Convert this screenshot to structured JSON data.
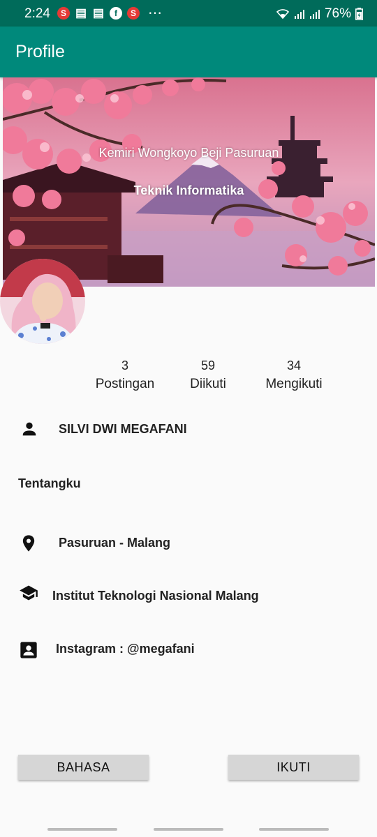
{
  "status_bar": {
    "time": "2:24",
    "notifications": [
      "s-app-icon",
      "gift-icon",
      "gift-icon",
      "facebook-icon",
      "s-app-icon"
    ],
    "s_glyph": "S",
    "fb_glyph": "f",
    "more": "⋯",
    "battery": "76%"
  },
  "app_bar": {
    "title": "Profile"
  },
  "cover": {
    "address": "Kemiri Wongkoyo Beji Pasuruan",
    "major": "Teknik Informatika"
  },
  "stats": [
    {
      "count": "3",
      "label": "Postingan"
    },
    {
      "count": "59",
      "label": "Diikuti"
    },
    {
      "count": "34",
      "label": "Mengikuti"
    }
  ],
  "profile": {
    "name": "SILVI DWI MEGAFANI",
    "about": "Tentangku",
    "location": "Pasuruan - Malang",
    "school": "Institut Teknologi Nasional Malang",
    "instagram": "Instagram : @megafani"
  },
  "buttons": {
    "language": "BAHASA",
    "follow": "IKUTI"
  },
  "colors": {
    "status_bar": "#006b5a",
    "app_bar": "#00897b",
    "button": "#d6d6d6",
    "background": "#fafafa"
  }
}
